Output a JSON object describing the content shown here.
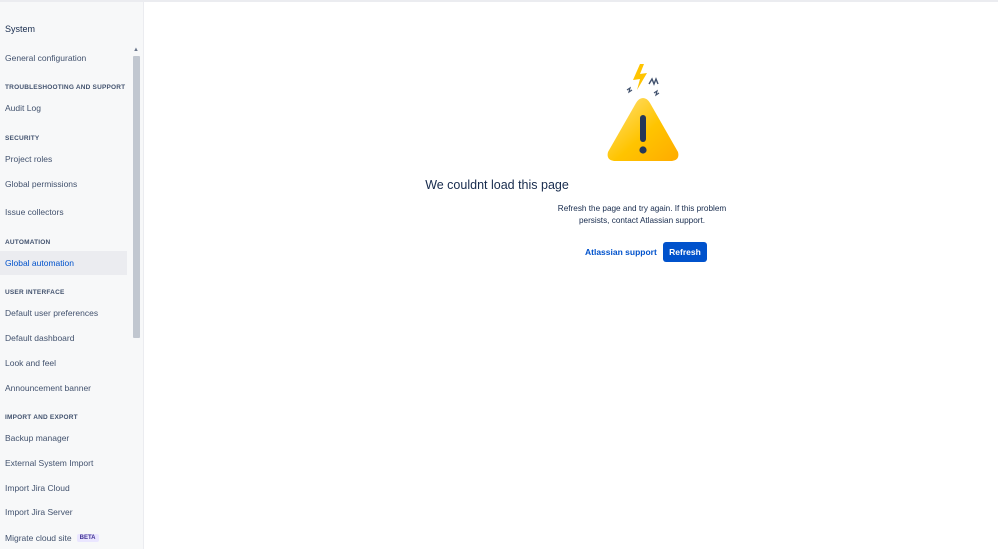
{
  "sidebar": {
    "title": "System",
    "items": {
      "general_configuration": "General configuration",
      "audit_log": "Audit Log",
      "project_roles": "Project roles",
      "global_permissions": "Global permissions",
      "issue_collectors": "Issue collectors",
      "global_automation": "Global automation",
      "default_user_preferences": "Default user preferences",
      "default_dashboard": "Default dashboard",
      "look_and_feel": "Look and feel",
      "announcement_banner": "Announcement banner",
      "backup_manager": "Backup manager",
      "external_system_import": "External System Import",
      "import_jira_cloud": "Import Jira Cloud",
      "import_jira_server": "Import Jira Server",
      "migrate_cloud_site": "Migrate cloud site"
    },
    "sections": {
      "troubleshooting": "TROUBLESHOOTING AND SUPPORT",
      "security": "SECURITY",
      "automation": "AUTOMATION",
      "user_interface": "USER INTERFACE",
      "import_export": "IMPORT AND EXPORT"
    },
    "beta_badge": "BETA",
    "active_item": "Global automation"
  },
  "error": {
    "title": "We couldnt load this page",
    "message": "Refresh the page and try again. If this problem persists, contact Atlassian support.",
    "support_link": "Atlassian support",
    "refresh_button": "Refresh"
  },
  "colors": {
    "accent": "#0052cc",
    "warning": "#ffc400",
    "sidebar_bg": "#f7f8f9",
    "beta_bg": "#eae6ff"
  },
  "icons": {
    "illustration": "warning-triangle-icon"
  }
}
